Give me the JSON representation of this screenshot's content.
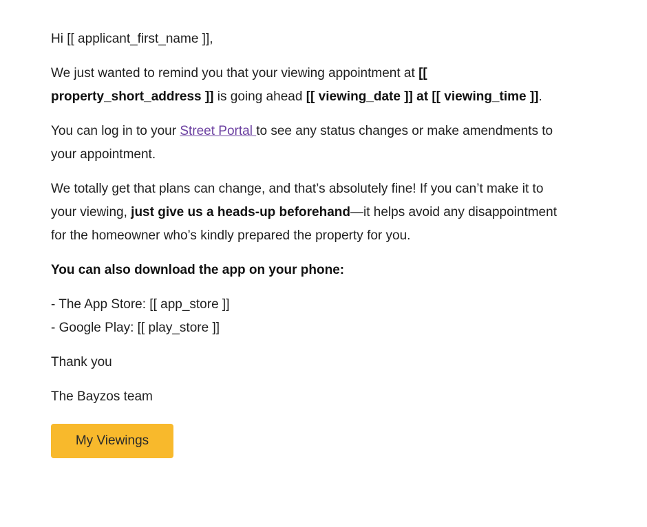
{
  "email": {
    "greeting": "Hi [[ applicant_first_name ]],",
    "p1": {
      "t1": "We just wanted to remind you that your viewing appointment at ",
      "b1": "[[ property_short_address ]]",
      "t2": " is going ahead ",
      "b2": "[[ viewing_date ]] at [[ viewing_time ]]",
      "t3": "."
    },
    "p2": {
      "t1": "You can log in to your ",
      "link": "Street Portal ",
      "t2": "to see any status changes or make amendments to your appointment."
    },
    "p3": {
      "t1": "We totally get that plans can change, and that’s absolutely fine! If you can’t make it to your viewing, ",
      "b1": "just give us a heads-up beforehand",
      "t2": "—it helps avoid any disappointment for the homeowner who’s kindly prepared the property for you."
    },
    "app_heading": "You can also download the app on your phone:",
    "stores": [
      "- The App Store: [[ app_store ]]",
      "- Google Play: [[ play_store ]]"
    ],
    "thanks": "Thank you",
    "signature": "The Bayzos team",
    "button_label": "My Viewings"
  },
  "colors": {
    "button": "#f8b92c",
    "link": "#6b3fa0",
    "text": "#1f1f1f"
  }
}
